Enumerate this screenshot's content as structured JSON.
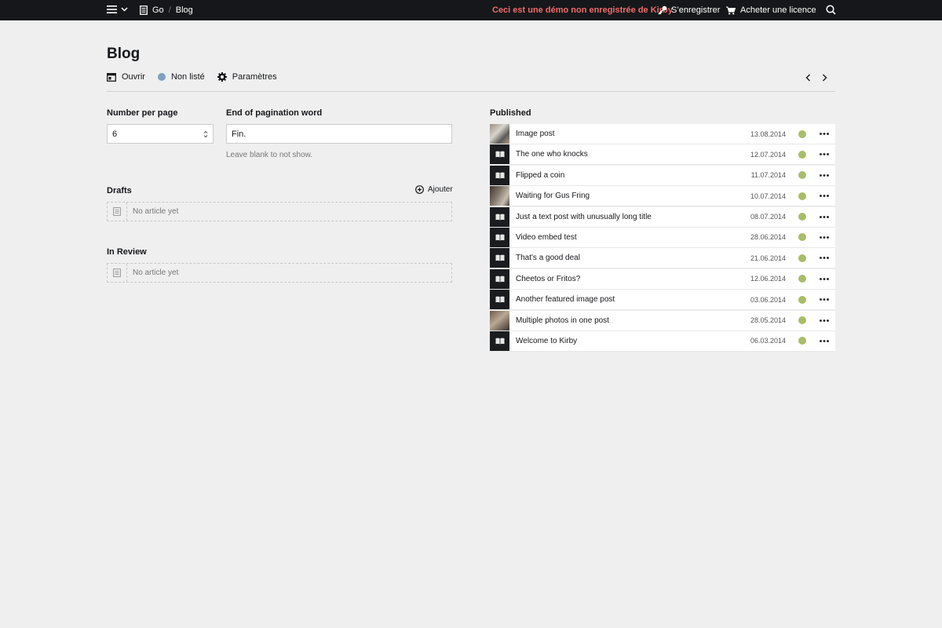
{
  "topbar": {
    "breadcrumb": [
      "Go",
      "Blog"
    ],
    "demo_notice": "Ceci est une démo non enregistrée de Kirby",
    "register_label": "S’enregistrer",
    "buy_label": "Acheter une licence"
  },
  "header": {
    "title": "Blog",
    "open_label": "Ouvrir",
    "status_label": "Non listé",
    "settings_label": "Paramètres"
  },
  "fields": {
    "per_page_label": "Number per page",
    "per_page_value": "6",
    "end_word_label": "End of pagination word",
    "end_word_value": "Fin.",
    "end_word_help": "Leave blank to not show."
  },
  "drafts": {
    "title": "Drafts",
    "add_label": "Ajouter",
    "empty_text": "No article yet"
  },
  "review": {
    "title": "In Review",
    "empty_text": "No article yet"
  },
  "published": {
    "title": "Published",
    "status_color": "#a7bd68",
    "items": [
      {
        "title": "Image post",
        "date": "13.08.2014",
        "thumb": "photo"
      },
      {
        "title": "The one who knocks",
        "date": "12.07.2014",
        "thumb": "book"
      },
      {
        "title": "Flipped a coin",
        "date": "11.07.2014",
        "thumb": "book"
      },
      {
        "title": "Waiting for Gus Fring",
        "date": "10.07.2014",
        "thumb": "photo3"
      },
      {
        "title": "Just a text post with unusually long title",
        "date": "08.07.2014",
        "thumb": "book"
      },
      {
        "title": "Video embed test",
        "date": "28.06.2014",
        "thumb": "book"
      },
      {
        "title": "That's a good deal",
        "date": "21.06.2014",
        "thumb": "book"
      },
      {
        "title": "Cheetos or Fritos?",
        "date": "12.06.2014",
        "thumb": "book"
      },
      {
        "title": "Another featured image post",
        "date": "03.06.2014",
        "thumb": "book"
      },
      {
        "title": "Multiple photos in one post",
        "date": "28.05.2014",
        "thumb": "photo4"
      },
      {
        "title": "Welcome to Kirby",
        "date": "06.03.2014",
        "thumb": "book"
      }
    ]
  }
}
